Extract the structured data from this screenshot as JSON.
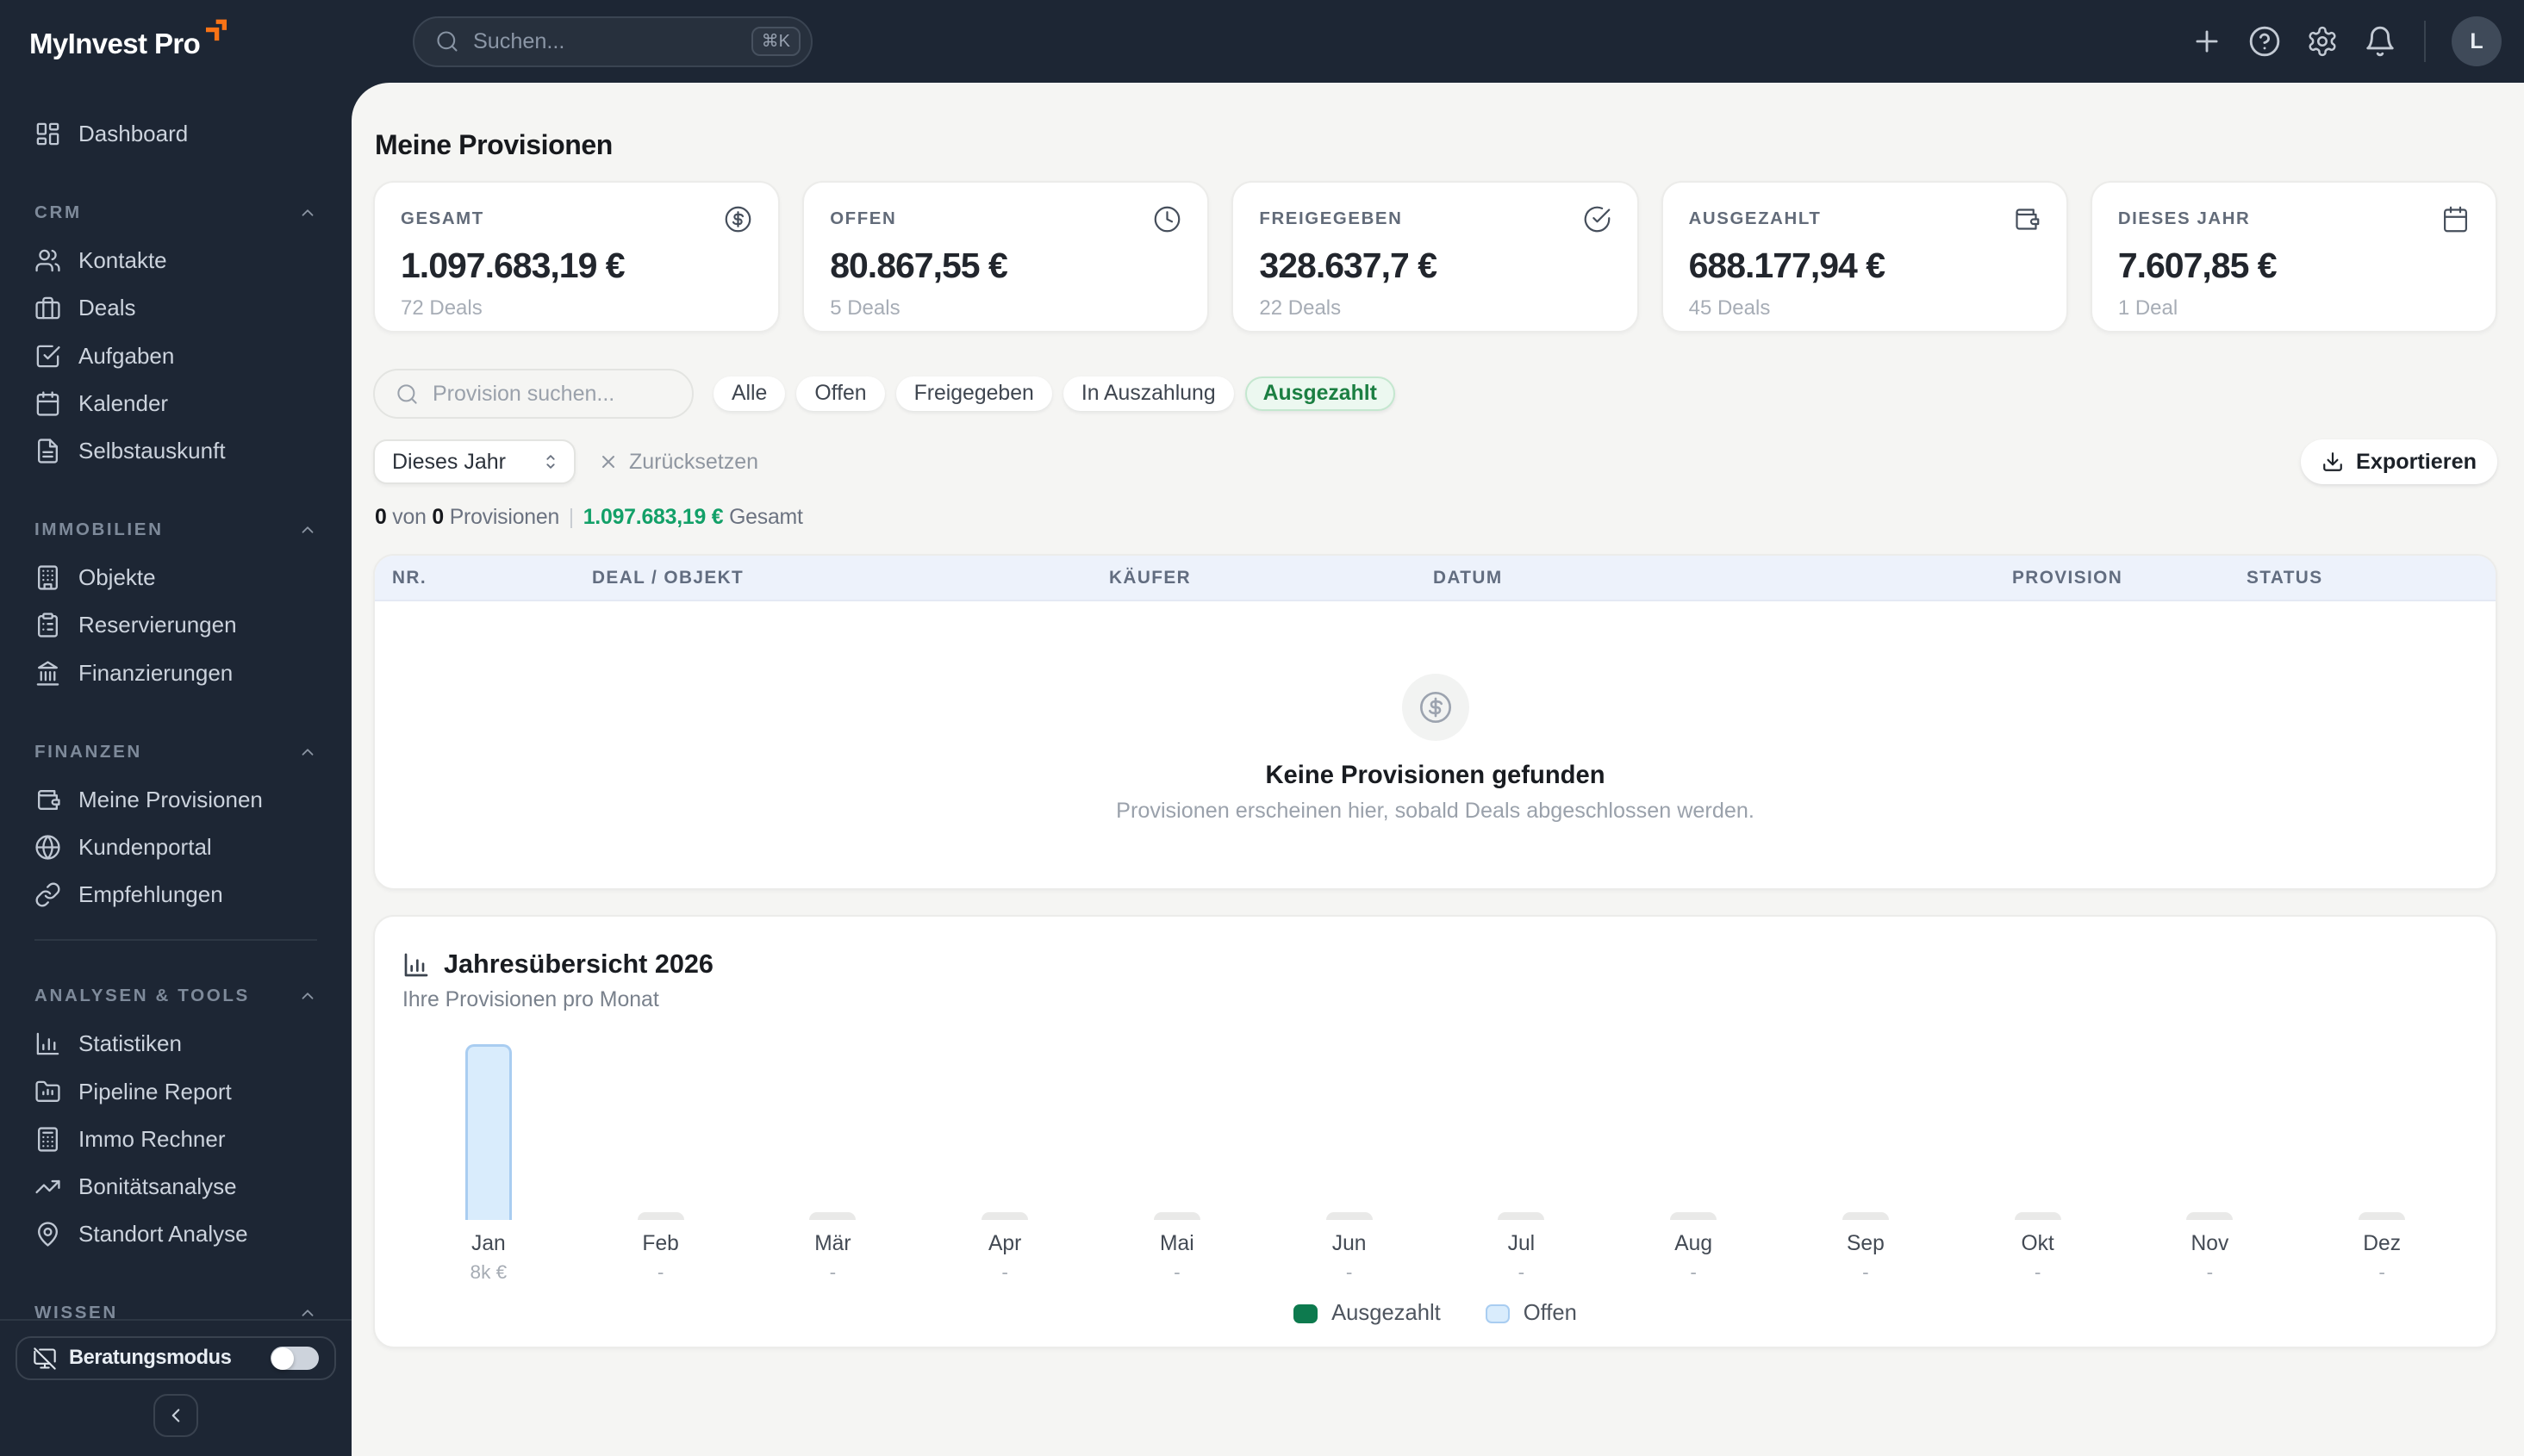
{
  "brand": {
    "name": "MyInvest Pro",
    "arrow_color": "#f97316"
  },
  "header": {
    "search_placeholder": "Suchen...",
    "search_shortcut": "⌘K",
    "avatar_initial": "L"
  },
  "sidebar": {
    "top_items": [
      {
        "id": "dashboard",
        "label": "Dashboard",
        "icon": "dashboard"
      }
    ],
    "sections": [
      {
        "label": "CRM",
        "items": [
          {
            "id": "kontakte",
            "label": "Kontakte",
            "icon": "users"
          },
          {
            "id": "deals",
            "label": "Deals",
            "icon": "briefcase"
          },
          {
            "id": "aufgaben",
            "label": "Aufgaben",
            "icon": "check-square"
          },
          {
            "id": "kalender",
            "label": "Kalender",
            "icon": "calendar"
          },
          {
            "id": "selbstauskunft",
            "label": "Selbstauskunft",
            "icon": "file-text"
          }
        ]
      },
      {
        "label": "IMMOBILIEN",
        "items": [
          {
            "id": "objekte",
            "label": "Objekte",
            "icon": "building"
          },
          {
            "id": "reservierungen",
            "label": "Reservierungen",
            "icon": "clipboard-list"
          },
          {
            "id": "finanzierungen",
            "label": "Finanzierungen",
            "icon": "landmark"
          }
        ]
      },
      {
        "label": "FINANZEN",
        "items": [
          {
            "id": "meine-provisionen",
            "label": "Meine Provisionen",
            "icon": "wallet"
          },
          {
            "id": "kundenportal",
            "label": "Kundenportal",
            "icon": "globe"
          },
          {
            "id": "empfehlungen",
            "label": "Empfehlungen",
            "icon": "link"
          }
        ]
      },
      {
        "label": "ANALYSEN & TOOLS",
        "divider_before": true,
        "items": [
          {
            "id": "statistiken",
            "label": "Statistiken",
            "icon": "bar-chart"
          },
          {
            "id": "pipeline-report",
            "label": "Pipeline Report",
            "icon": "folder-chart"
          },
          {
            "id": "immo-rechner",
            "label": "Immo Rechner",
            "icon": "calculator"
          },
          {
            "id": "bonitaetsanalyse",
            "label": "Bonitätsanalyse",
            "icon": "trending-up"
          },
          {
            "id": "standort-analyse",
            "label": "Standort Analyse",
            "icon": "map-pin"
          }
        ]
      },
      {
        "label": "WISSEN",
        "items": []
      }
    ],
    "footer": {
      "consult_mode_label": "Beratungsmodus",
      "consult_mode_on": false
    }
  },
  "page": {
    "title": "Meine Provisionen",
    "stat_cards": [
      {
        "label": "GESAMT",
        "value": "1.097.683,19 €",
        "sub": "72 Deals",
        "icon": "dollar-circle"
      },
      {
        "label": "OFFEN",
        "value": "80.867,55 €",
        "sub": "5 Deals",
        "icon": "clock"
      },
      {
        "label": "FREIGEGEBEN",
        "value": "328.637,7 €",
        "sub": "22 Deals",
        "icon": "check-circle"
      },
      {
        "label": "AUSGEZAHLT",
        "value": "688.177,94 €",
        "sub": "45 Deals",
        "icon": "wallet"
      },
      {
        "label": "DIESES JAHR",
        "value": "7.607,85 €",
        "sub": "1 Deal",
        "icon": "calendar"
      }
    ],
    "filters": {
      "search_placeholder": "Provision suchen...",
      "pills": [
        "Alle",
        "Offen",
        "Freigegeben",
        "In Auszahlung",
        "Ausgezahlt"
      ],
      "active_pill": "Ausgezahlt"
    },
    "toolbar": {
      "period_select": "Dieses Jahr",
      "reset_label": "Zurücksetzen",
      "export_label": "Exportieren"
    },
    "summary": {
      "count_shown": "0",
      "of_word": "von",
      "count_total": "0",
      "noun": "Provisionen",
      "total_value": "1.097.683,19 €",
      "total_word": "Gesamt"
    },
    "table": {
      "columns": [
        "NR.",
        "DEAL / OBJEKT",
        "KÄUFER",
        "DATUM",
        "PROVISION",
        "STATUS"
      ],
      "empty_title": "Keine Provisionen gefunden",
      "empty_subtitle": "Provisionen erscheinen hier, sobald Deals abgeschlossen werden."
    }
  },
  "chart_data": {
    "type": "bar",
    "title": "Jahresübersicht 2026",
    "subtitle": "Ihre Provisionen pro Monat",
    "categories": [
      "Jan",
      "Feb",
      "Mär",
      "Apr",
      "Mai",
      "Jun",
      "Jul",
      "Aug",
      "Sep",
      "Okt",
      "Nov",
      "Dez"
    ],
    "series": [
      {
        "name": "Ausgezahlt",
        "color": "#0d7a4e",
        "values": [
          0,
          0,
          0,
          0,
          0,
          0,
          0,
          0,
          0,
          0,
          0,
          0
        ]
      },
      {
        "name": "Offen",
        "color": "#d9ecfc",
        "values": [
          8000,
          0,
          0,
          0,
          0,
          0,
          0,
          0,
          0,
          0,
          0,
          0
        ]
      }
    ],
    "value_labels": [
      "8k €",
      "-",
      "-",
      "-",
      "-",
      "-",
      "-",
      "-",
      "-",
      "-",
      "-",
      "-"
    ],
    "ylim": [
      0,
      8800
    ],
    "legend_position": "bottom",
    "grid": false
  }
}
